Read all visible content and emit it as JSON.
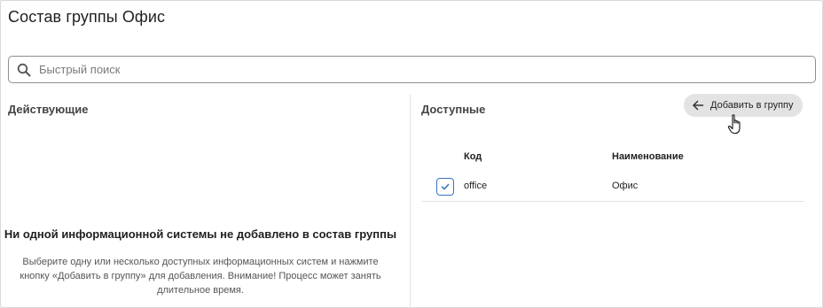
{
  "page": {
    "title": "Состав группы Офис"
  },
  "search": {
    "placeholder": "Быстрый поиск",
    "value": ""
  },
  "active_panel": {
    "title": "Действующие",
    "empty_heading": "Ни одной информационной системы не добавлено в состав группы",
    "empty_text": "Выберите одну или несколько доступных информационных систем и нажмите кнопку «Добавить в группу» для добавления. Внимание! Процесс может занять длительное время."
  },
  "available_panel": {
    "title": "Доступные",
    "add_button_label": "Добавить в группу",
    "columns": {
      "code": "Код",
      "name": "Наименование"
    },
    "rows": [
      {
        "code": "office",
        "name": "Офис",
        "checked": true
      }
    ]
  },
  "colors": {
    "accent": "#3a73c4",
    "button_bg": "#e3e3e3",
    "border": "#8f8f8f"
  },
  "icons": {
    "search": "search-icon",
    "add": "arrow-left-icon",
    "cursor": "hand-pointer-icon",
    "check": "checkmark-icon"
  }
}
